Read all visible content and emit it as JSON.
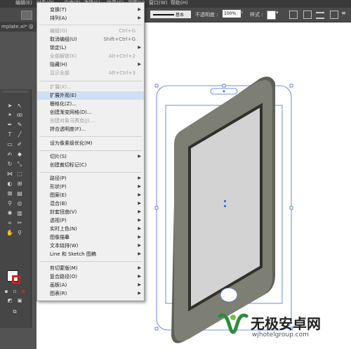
{
  "menubar": {
    "items": [
      "编辑(E)",
      "对象(O)",
      "文字(T)",
      "选择(S)",
      "效果(C)",
      "视图(V)",
      "窗口(W)",
      "帮助(H)"
    ]
  },
  "controlbar": {
    "stroke_label": "基本",
    "opacity_label": "不透明度 :",
    "opacity_value": "100%",
    "style_label": "样式 :"
  },
  "doctab": {
    "title": "mplate.ai* @"
  },
  "menu": {
    "items": [
      {
        "label": "变换(T)",
        "shortcut": "",
        "submenu": true,
        "disabled": false
      },
      {
        "label": "排列(A)",
        "shortcut": "",
        "submenu": true,
        "disabled": false
      },
      {
        "label": "编组(G)",
        "shortcut": "Ctrl+G",
        "submenu": false,
        "disabled": true
      },
      {
        "label": "取消编组(U)",
        "shortcut": "Shift+Ctrl+G",
        "submenu": false,
        "disabled": false
      },
      {
        "label": "锁定(L)",
        "shortcut": "",
        "submenu": true,
        "disabled": false
      },
      {
        "label": "全部解锁(K)",
        "shortcut": "Alt+Ctrl+2",
        "submenu": false,
        "disabled": true
      },
      {
        "label": "隐藏(H)",
        "shortcut": "",
        "submenu": true,
        "disabled": false
      },
      {
        "label": "显示全部",
        "shortcut": "Alt+Ctrl+3",
        "submenu": false,
        "disabled": true
      },
      {
        "label": "扩展(X)...",
        "shortcut": "",
        "submenu": false,
        "disabled": true
      },
      {
        "label": "扩展外观(E)",
        "shortcut": "",
        "submenu": false,
        "disabled": false,
        "highlighted": true
      },
      {
        "label": "栅格化(Z)...",
        "shortcut": "",
        "submenu": false,
        "disabled": false
      },
      {
        "label": "创建渐变网格(D)...",
        "shortcut": "",
        "submenu": false,
        "disabled": false
      },
      {
        "label": "创建对象马赛克(J)...",
        "shortcut": "",
        "submenu": false,
        "disabled": true
      },
      {
        "label": "拼合透明度(F)...",
        "shortcut": "",
        "submenu": false,
        "disabled": false
      },
      {
        "label": "设为像素级优化(M)",
        "shortcut": "",
        "submenu": false,
        "disabled": false
      },
      {
        "label": "切片(S)",
        "shortcut": "",
        "submenu": true,
        "disabled": false
      },
      {
        "label": "创建裁切标记(C)",
        "shortcut": "",
        "submenu": false,
        "disabled": false
      },
      {
        "label": "路径(P)",
        "shortcut": "",
        "submenu": true,
        "disabled": false
      },
      {
        "label": "形状(P)",
        "shortcut": "",
        "submenu": true,
        "disabled": false
      },
      {
        "label": "图案(E)",
        "shortcut": "",
        "submenu": true,
        "disabled": false
      },
      {
        "label": "混合(B)",
        "shortcut": "",
        "submenu": true,
        "disabled": false
      },
      {
        "label": "封套扭曲(V)",
        "shortcut": "",
        "submenu": true,
        "disabled": false
      },
      {
        "label": "透视(P)",
        "shortcut": "",
        "submenu": true,
        "disabled": false
      },
      {
        "label": "实时上色(N)",
        "shortcut": "",
        "submenu": true,
        "disabled": false
      },
      {
        "label": "图像描摹",
        "shortcut": "",
        "submenu": true,
        "disabled": false
      },
      {
        "label": "文本绕排(W)",
        "shortcut": "",
        "submenu": true,
        "disabled": false
      },
      {
        "label": "Line 和 Sketch 图稿",
        "shortcut": "",
        "submenu": true,
        "disabled": false
      },
      {
        "label": "剪切蒙版(M)",
        "shortcut": "",
        "submenu": true,
        "disabled": false
      },
      {
        "label": "复合路径(O)",
        "shortcut": "",
        "submenu": true,
        "disabled": false
      },
      {
        "label": "画板(A)",
        "shortcut": "",
        "submenu": true,
        "disabled": false
      },
      {
        "label": "图表(R)",
        "shortcut": "",
        "submenu": true,
        "disabled": false
      }
    ]
  },
  "watermark": {
    "text": "无极安卓网",
    "url": "wjhotelgroup.com"
  },
  "colors": {
    "accent_selection": "#4a6fd8",
    "phone_body": "#7d7f74",
    "phone_screen": "#d3d3d3"
  },
  "icons": [
    "arrow-icon",
    "direct-select-icon",
    "magic-wand-icon",
    "lasso-icon",
    "pen-icon",
    "curvature-icon",
    "type-icon",
    "line-icon",
    "rectangle-icon",
    "paintbrush-icon",
    "shaper-icon",
    "eraser-icon",
    "rotate-icon",
    "scale-icon",
    "width-icon",
    "free-transform-icon",
    "shape-builder-icon",
    "perspective-icon",
    "mesh-icon",
    "gradient-icon",
    "eyedropper-icon",
    "blend-icon",
    "symbol-sprayer-icon",
    "column-graph-icon",
    "artboard-icon",
    "slice-icon",
    "hand-icon",
    "zoom-icon",
    "fill-stroke-icon",
    "screen-mode-icon"
  ]
}
